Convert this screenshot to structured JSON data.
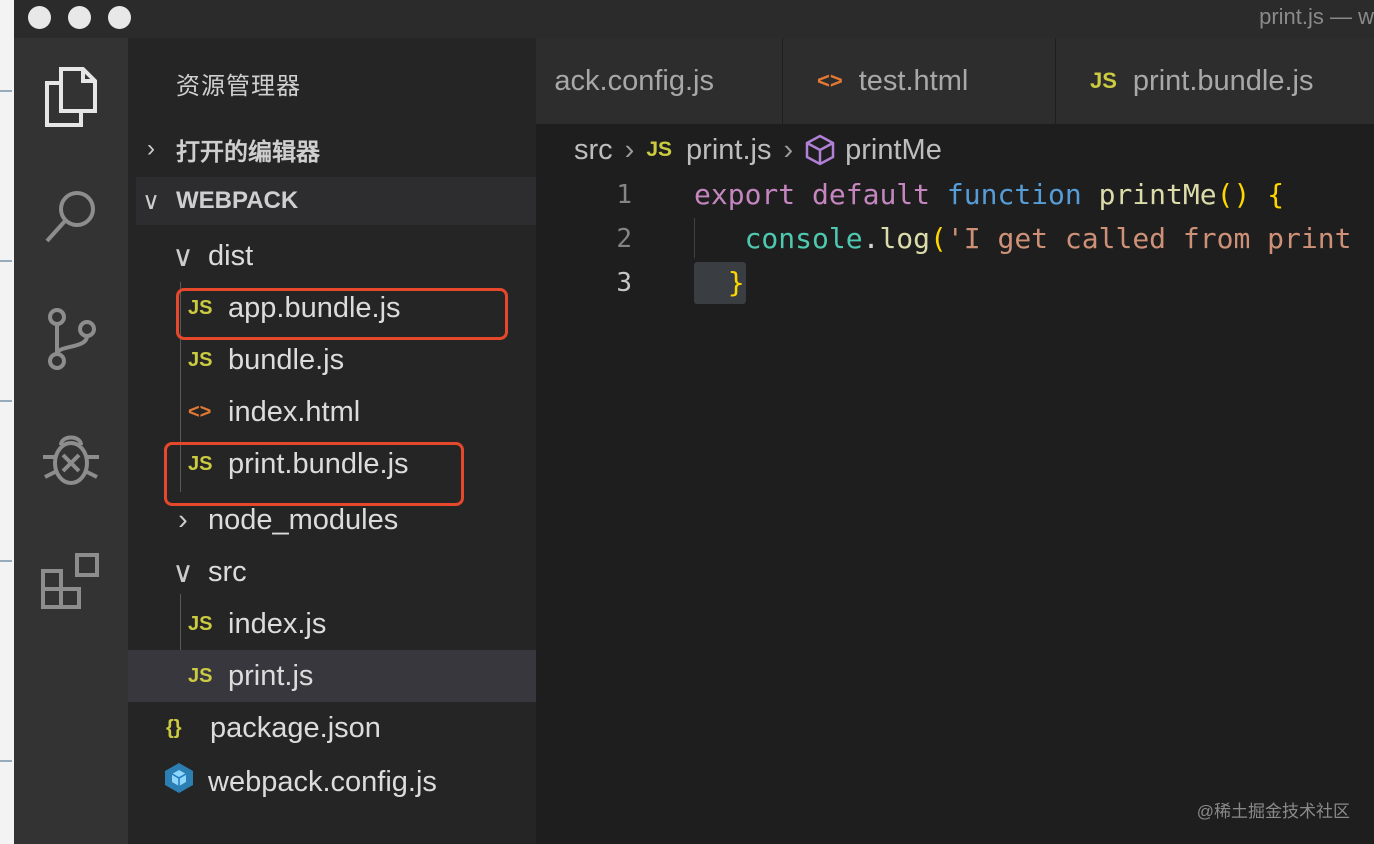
{
  "window": {
    "title": "print.js — w"
  },
  "sidebar": {
    "title": "资源管理器",
    "open_editors": "打开的编辑器",
    "workspace": "WEBPACK",
    "tree": [
      {
        "label": "dist",
        "type": "folder",
        "expanded": true
      },
      {
        "label": "app.bundle.js",
        "type": "js",
        "icon": "JS",
        "highlighted": true
      },
      {
        "label": "bundle.js",
        "type": "js",
        "icon": "JS"
      },
      {
        "label": "index.html",
        "type": "html",
        "icon": "<>"
      },
      {
        "label": "print.bundle.js",
        "type": "js",
        "icon": "JS",
        "highlighted": true
      },
      {
        "label": "node_modules",
        "type": "folder",
        "expanded": false
      },
      {
        "label": "src",
        "type": "folder",
        "expanded": true
      },
      {
        "label": "index.js",
        "type": "js",
        "icon": "JS"
      },
      {
        "label": "print.js",
        "type": "js",
        "icon": "JS",
        "selected": true
      },
      {
        "label": "package.json",
        "type": "json",
        "icon": "{}"
      },
      {
        "label": "webpack.config.js",
        "type": "webpack",
        "icon": "webpack-cube-icon"
      }
    ]
  },
  "tabs": [
    {
      "label": "ack.config.js"
    },
    {
      "label": "test.html",
      "icon": "<>"
    },
    {
      "label": "print.bundle.js",
      "icon": "JS"
    }
  ],
  "breadcrumb": {
    "folder": "src",
    "file_icon": "JS",
    "file": "print.js",
    "symbol": "printMe"
  },
  "editor": {
    "line_numbers": [
      "1",
      "2",
      "3"
    ],
    "line1": {
      "kw1": "export",
      "kw2": "default",
      "kw3": "function",
      "name": "printMe",
      "parens": "()",
      "brace": "{"
    },
    "line2": {
      "obj": "console",
      "dot": ".",
      "method": "log",
      "paren": "(",
      "str": "'I get called from print"
    },
    "line3": {
      "brace": "}"
    }
  },
  "colors": {
    "highlight_border": "#e5482a",
    "js_icon": "#cbcb41",
    "html_icon": "#e37933",
    "webpack_icon": "#5fa8d3"
  },
  "watermark": "@稀土掘金技术社区"
}
